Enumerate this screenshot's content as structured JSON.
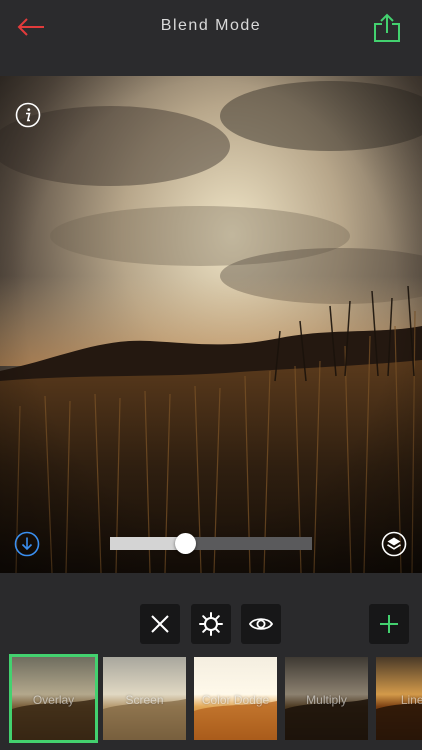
{
  "header": {
    "title": "Blend Mode",
    "back_icon": "arrow-left-icon",
    "share_icon": "share-icon"
  },
  "colors": {
    "accent_green": "#43d16f",
    "back_red": "#e23b3b",
    "download_blue": "#3a8ff0",
    "background": "#2a2a2c"
  },
  "photo": {
    "info_icon": "info-icon",
    "download_icon": "download-icon",
    "layers_icon": "layers-icon"
  },
  "opacity_slider": {
    "value": 0.37
  },
  "toolbar": {
    "items": [
      {
        "name": "close",
        "icon": "close-icon"
      },
      {
        "name": "settings",
        "icon": "gear-icon"
      },
      {
        "name": "preview",
        "icon": "eye-icon"
      },
      {
        "name": "add",
        "icon": "plus-icon"
      }
    ]
  },
  "blend_modes": {
    "items": [
      {
        "label": "Overlay",
        "selected": true
      },
      {
        "label": "Screen",
        "selected": false
      },
      {
        "label": "Color Dodge",
        "selected": false
      },
      {
        "label": "Multiply",
        "selected": false
      },
      {
        "label": "Linear",
        "selected": false
      }
    ]
  }
}
